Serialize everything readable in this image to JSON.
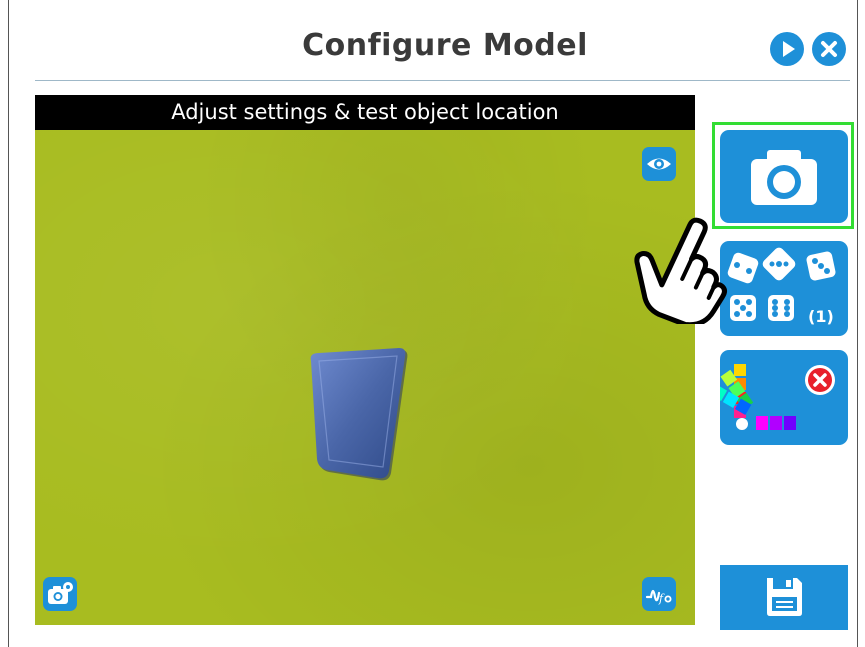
{
  "header": {
    "title": "Configure Model",
    "play_icon": "play-icon",
    "close_icon": "close-icon"
  },
  "camera_view": {
    "banner_text": "Adjust settings & test object location",
    "icons": {
      "visibility": "eye-icon",
      "camera_settings": "camera-settings-icon",
      "signal": "signal-function-icon"
    }
  },
  "sidebar": {
    "snapshot_icon": "camera-icon",
    "samples": {
      "icon": "dice-icon",
      "count_label": "(1)"
    },
    "color_filter_icon": "color-palette-icon",
    "save_icon": "save-icon"
  },
  "colors": {
    "accent": "#1e90d8",
    "highlight": "#33dd33",
    "camera_background": "#a8bc20",
    "object": "#4a66a8"
  }
}
